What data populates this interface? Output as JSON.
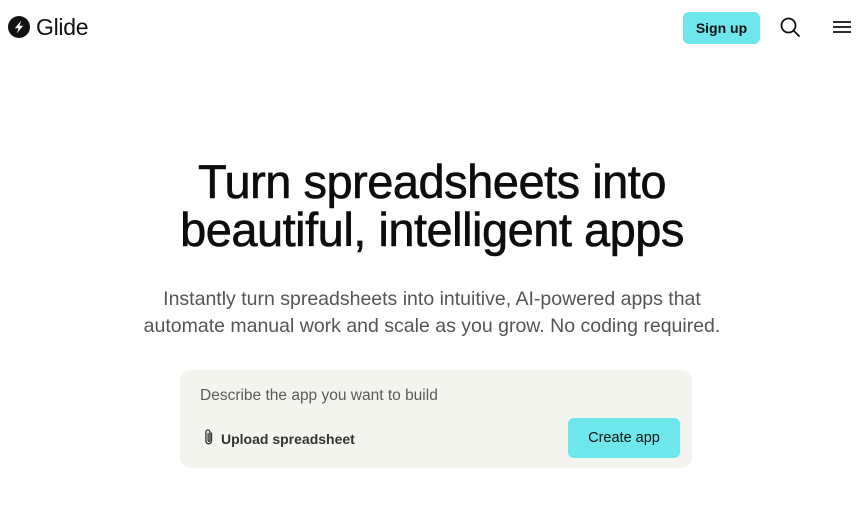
{
  "header": {
    "logo_text": "Glide",
    "logo_icon": "bolt-circle-icon",
    "signup_label": "Sign up",
    "search_icon": "search-icon",
    "menu_icon": "hamburger-menu-icon"
  },
  "hero": {
    "title_line1": "Turn spreadsheets into",
    "title_line2": "beautiful, intelligent apps",
    "subtitle_line1": "Instantly turn spreadsheets into intuitive, AI-powered apps that",
    "subtitle_line2": "automate manual work and scale as you grow. No coding required."
  },
  "prompt": {
    "placeholder": "Describe the app you want to build",
    "value": "",
    "upload_label": "Upload spreadsheet",
    "upload_icon": "paperclip-icon",
    "create_label": "Create app"
  },
  "colors": {
    "accent": "#6ee7ec",
    "prompt_background": "#f4f4ef",
    "text": "#111111",
    "subtext": "#555555"
  }
}
